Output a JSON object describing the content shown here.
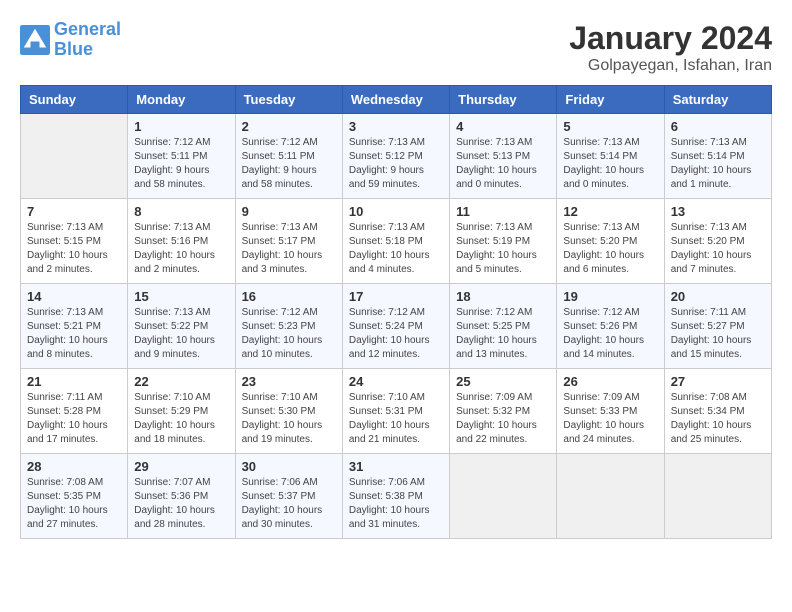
{
  "header": {
    "logo_line1": "General",
    "logo_line2": "Blue",
    "month": "January 2024",
    "location": "Golpayegan, Isfahan, Iran"
  },
  "days_of_week": [
    "Sunday",
    "Monday",
    "Tuesday",
    "Wednesday",
    "Thursday",
    "Friday",
    "Saturday"
  ],
  "weeks": [
    [
      {
        "day": "",
        "info": ""
      },
      {
        "day": "1",
        "info": "Sunrise: 7:12 AM\nSunset: 5:11 PM\nDaylight: 9 hours\nand 58 minutes."
      },
      {
        "day": "2",
        "info": "Sunrise: 7:12 AM\nSunset: 5:11 PM\nDaylight: 9 hours\nand 58 minutes."
      },
      {
        "day": "3",
        "info": "Sunrise: 7:13 AM\nSunset: 5:12 PM\nDaylight: 9 hours\nand 59 minutes."
      },
      {
        "day": "4",
        "info": "Sunrise: 7:13 AM\nSunset: 5:13 PM\nDaylight: 10 hours\nand 0 minutes."
      },
      {
        "day": "5",
        "info": "Sunrise: 7:13 AM\nSunset: 5:14 PM\nDaylight: 10 hours\nand 0 minutes."
      },
      {
        "day": "6",
        "info": "Sunrise: 7:13 AM\nSunset: 5:14 PM\nDaylight: 10 hours\nand 1 minute."
      }
    ],
    [
      {
        "day": "7",
        "info": "Sunrise: 7:13 AM\nSunset: 5:15 PM\nDaylight: 10 hours\nand 2 minutes."
      },
      {
        "day": "8",
        "info": "Sunrise: 7:13 AM\nSunset: 5:16 PM\nDaylight: 10 hours\nand 2 minutes."
      },
      {
        "day": "9",
        "info": "Sunrise: 7:13 AM\nSunset: 5:17 PM\nDaylight: 10 hours\nand 3 minutes."
      },
      {
        "day": "10",
        "info": "Sunrise: 7:13 AM\nSunset: 5:18 PM\nDaylight: 10 hours\nand 4 minutes."
      },
      {
        "day": "11",
        "info": "Sunrise: 7:13 AM\nSunset: 5:19 PM\nDaylight: 10 hours\nand 5 minutes."
      },
      {
        "day": "12",
        "info": "Sunrise: 7:13 AM\nSunset: 5:20 PM\nDaylight: 10 hours\nand 6 minutes."
      },
      {
        "day": "13",
        "info": "Sunrise: 7:13 AM\nSunset: 5:20 PM\nDaylight: 10 hours\nand 7 minutes."
      }
    ],
    [
      {
        "day": "14",
        "info": "Sunrise: 7:13 AM\nSunset: 5:21 PM\nDaylight: 10 hours\nand 8 minutes."
      },
      {
        "day": "15",
        "info": "Sunrise: 7:13 AM\nSunset: 5:22 PM\nDaylight: 10 hours\nand 9 minutes."
      },
      {
        "day": "16",
        "info": "Sunrise: 7:12 AM\nSunset: 5:23 PM\nDaylight: 10 hours\nand 10 minutes."
      },
      {
        "day": "17",
        "info": "Sunrise: 7:12 AM\nSunset: 5:24 PM\nDaylight: 10 hours\nand 12 minutes."
      },
      {
        "day": "18",
        "info": "Sunrise: 7:12 AM\nSunset: 5:25 PM\nDaylight: 10 hours\nand 13 minutes."
      },
      {
        "day": "19",
        "info": "Sunrise: 7:12 AM\nSunset: 5:26 PM\nDaylight: 10 hours\nand 14 minutes."
      },
      {
        "day": "20",
        "info": "Sunrise: 7:11 AM\nSunset: 5:27 PM\nDaylight: 10 hours\nand 15 minutes."
      }
    ],
    [
      {
        "day": "21",
        "info": "Sunrise: 7:11 AM\nSunset: 5:28 PM\nDaylight: 10 hours\nand 17 minutes."
      },
      {
        "day": "22",
        "info": "Sunrise: 7:10 AM\nSunset: 5:29 PM\nDaylight: 10 hours\nand 18 minutes."
      },
      {
        "day": "23",
        "info": "Sunrise: 7:10 AM\nSunset: 5:30 PM\nDaylight: 10 hours\nand 19 minutes."
      },
      {
        "day": "24",
        "info": "Sunrise: 7:10 AM\nSunset: 5:31 PM\nDaylight: 10 hours\nand 21 minutes."
      },
      {
        "day": "25",
        "info": "Sunrise: 7:09 AM\nSunset: 5:32 PM\nDaylight: 10 hours\nand 22 minutes."
      },
      {
        "day": "26",
        "info": "Sunrise: 7:09 AM\nSunset: 5:33 PM\nDaylight: 10 hours\nand 24 minutes."
      },
      {
        "day": "27",
        "info": "Sunrise: 7:08 AM\nSunset: 5:34 PM\nDaylight: 10 hours\nand 25 minutes."
      }
    ],
    [
      {
        "day": "28",
        "info": "Sunrise: 7:08 AM\nSunset: 5:35 PM\nDaylight: 10 hours\nand 27 minutes."
      },
      {
        "day": "29",
        "info": "Sunrise: 7:07 AM\nSunset: 5:36 PM\nDaylight: 10 hours\nand 28 minutes."
      },
      {
        "day": "30",
        "info": "Sunrise: 7:06 AM\nSunset: 5:37 PM\nDaylight: 10 hours\nand 30 minutes."
      },
      {
        "day": "31",
        "info": "Sunrise: 7:06 AM\nSunset: 5:38 PM\nDaylight: 10 hours\nand 31 minutes."
      },
      {
        "day": "",
        "info": ""
      },
      {
        "day": "",
        "info": ""
      },
      {
        "day": "",
        "info": ""
      }
    ]
  ]
}
